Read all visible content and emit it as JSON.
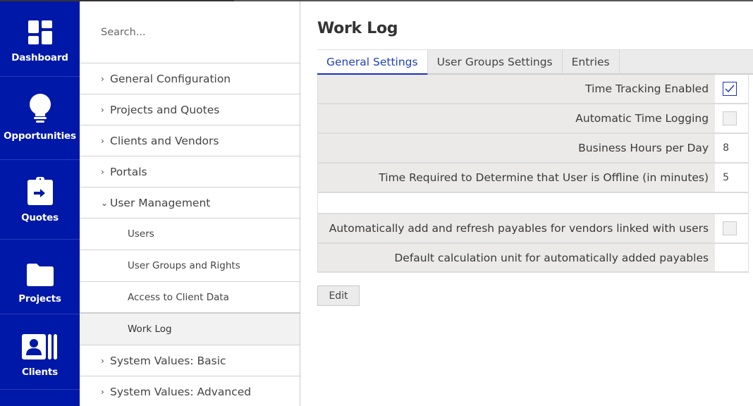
{
  "colors": {
    "nav_bg": "#0018a8",
    "accent": "#1a2fbf",
    "label_bg": "#ebeae9"
  },
  "nav": {
    "items": [
      {
        "label": "Dashboard",
        "icon": "dashboard-icon"
      },
      {
        "label": "Opportunities",
        "icon": "lightbulb-icon"
      },
      {
        "label": "Quotes",
        "icon": "clipboard-arrow-icon"
      },
      {
        "label": "Projects",
        "icon": "folder-icon"
      },
      {
        "label": "Clients",
        "icon": "contact-card-icon"
      }
    ]
  },
  "sidebar": {
    "search_placeholder": "Search...",
    "items": [
      {
        "label": "General Configuration",
        "chevron": "›"
      },
      {
        "label": "Projects and Quotes",
        "chevron": "›"
      },
      {
        "label": "Clients and Vendors",
        "chevron": "›"
      },
      {
        "label": "Portals",
        "chevron": "›"
      },
      {
        "label": "User Management",
        "chevron": "⌄"
      },
      {
        "label": "Users"
      },
      {
        "label": "User Groups and Rights"
      },
      {
        "label": "Access to Client Data"
      },
      {
        "label": "Work Log"
      },
      {
        "label": "System Values: Basic",
        "chevron": "›"
      },
      {
        "label": "System Values: Advanced",
        "chevron": "›"
      }
    ]
  },
  "main": {
    "title": "Work Log",
    "tabs": [
      {
        "label": "General Settings",
        "active": true
      },
      {
        "label": "User Groups Settings",
        "active": false
      },
      {
        "label": "Entries",
        "active": false
      }
    ],
    "settings": [
      {
        "label": "Time Tracking Enabled",
        "type": "checkbox",
        "checked": true
      },
      {
        "label": "Automatic Time Logging",
        "type": "checkbox",
        "checked": false
      },
      {
        "label": "Business Hours per Day",
        "type": "text",
        "value": "8"
      },
      {
        "label": "Time Required to Determine that User is Offline (in minutes)",
        "type": "text",
        "value": "5"
      },
      {
        "label": "",
        "type": "blank"
      },
      {
        "label": "Automatically add and refresh payables for vendors linked with users",
        "type": "checkbox",
        "checked": false
      },
      {
        "label": "Default calculation unit for automatically added payables",
        "type": "text",
        "value": ""
      }
    ],
    "edit_label": "Edit"
  }
}
